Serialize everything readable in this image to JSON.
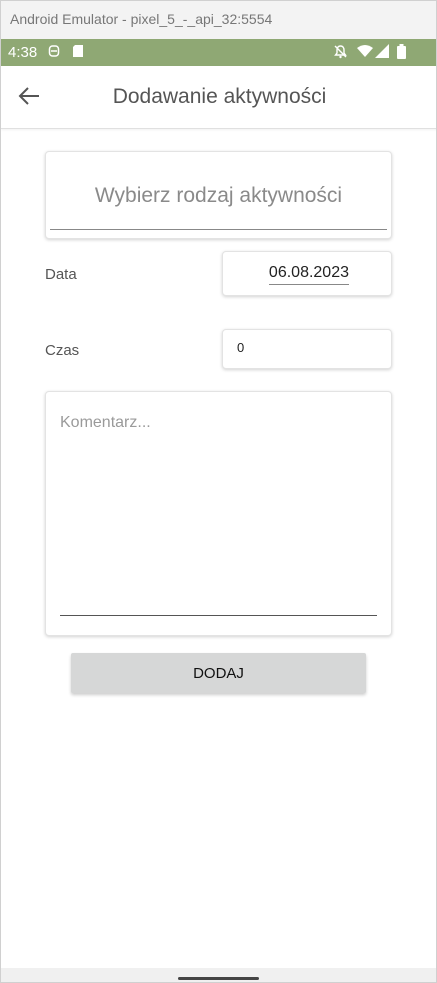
{
  "window": {
    "title": "Android Emulator - pixel_5_-_api_32:5554"
  },
  "status_bar": {
    "time": "4:38",
    "background": "#8fa874",
    "left_icons": [
      "sync-icon",
      "sd-card-icon"
    ],
    "right_icons": [
      "notifications-off-icon",
      "wifi-icon",
      "signal-icon",
      "battery-icon"
    ]
  },
  "app_bar": {
    "title": "Dodawanie aktywności",
    "back_icon": "back-arrow-icon"
  },
  "form": {
    "activity_type_placeholder": "Wybierz rodzaj aktywności",
    "date_label": "Data",
    "date_value": "06.08.2023",
    "time_label": "Czas",
    "time_value": "0",
    "comment_placeholder": "Komentarz...",
    "submit_label": "DODAJ"
  },
  "colors": {
    "status_bar": "#8fa874",
    "button_background": "#d6d7d7",
    "page_background": "#ffffff"
  }
}
